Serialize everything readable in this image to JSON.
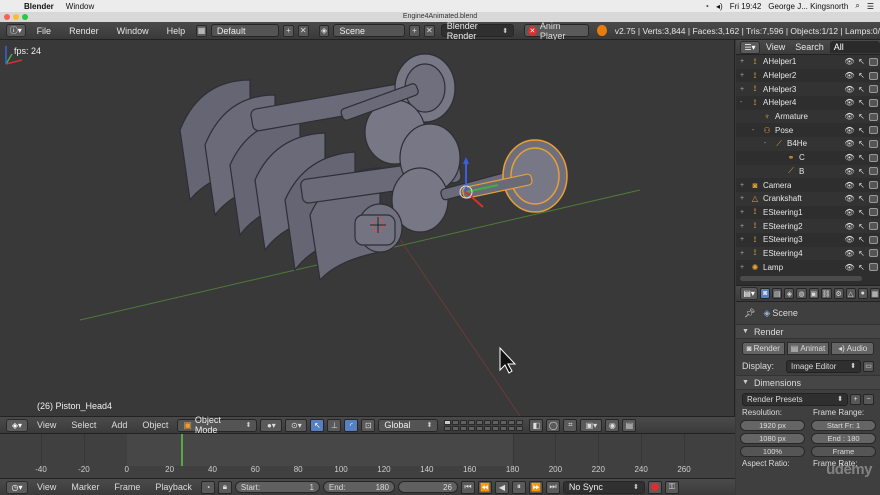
{
  "os_menu": {
    "apple": "",
    "app_name": "Blender",
    "items": [
      "Window"
    ],
    "clock": "Fri 19:42",
    "user": "George J... Kingsnorth"
  },
  "window": {
    "title": "Engine4Animated.blend"
  },
  "info_header": {
    "menus": [
      "File",
      "Render",
      "Window",
      "Help"
    ],
    "layout": "Default",
    "scene": "Scene",
    "render_engine": "Blender Render",
    "anim_player": "Anim Player",
    "stats": "v2.75 | Verts:3,844 | Faces:3,162 | Tris:7,596 | Objects:1/12 | Lamps:0/"
  },
  "viewport": {
    "fps": "fps: 24",
    "active_object": "(26) Piston_Head4"
  },
  "viewport_header": {
    "menus": [
      "View",
      "Select",
      "Add",
      "Object"
    ],
    "mode": "Object Mode",
    "orientation": "Global"
  },
  "timeline": {
    "ticks": [
      "-40",
      "-20",
      "0",
      "20",
      "40",
      "60",
      "80",
      "100",
      "120",
      "140",
      "160",
      "180",
      "200",
      "220",
      "240",
      "260"
    ],
    "range_start": 0,
    "range_end": 180,
    "current_frame": 26,
    "tick_min": -40,
    "tick_max": 260
  },
  "timeline_header": {
    "menus": [
      "View",
      "Marker",
      "Frame",
      "Playback"
    ],
    "start_label": "Start:",
    "start_value": "1",
    "end_label": "End:",
    "end_value": "180",
    "current": "26",
    "sync": "No Sync"
  },
  "outliner": {
    "tabs": [
      "View",
      "Search",
      "All Scenes"
    ],
    "rows": [
      {
        "name": "AHelper1",
        "icon": "empty-icon",
        "indent": 0,
        "expand": "+"
      },
      {
        "name": "AHelper2",
        "icon": "empty-icon",
        "indent": 0,
        "expand": "+"
      },
      {
        "name": "AHelper3",
        "icon": "empty-icon",
        "indent": 0,
        "expand": "+"
      },
      {
        "name": "AHelper4",
        "icon": "empty-icon",
        "indent": 0,
        "expand": "-"
      },
      {
        "name": "Armature",
        "icon": "armature-icon",
        "indent": 1,
        "expand": ""
      },
      {
        "name": "Pose",
        "icon": "pose-icon",
        "indent": 1,
        "expand": "-"
      },
      {
        "name": "B4He",
        "icon": "bone-icon",
        "indent": 2,
        "expand": "-"
      },
      {
        "name": "C",
        "icon": "constraint-icon",
        "indent": 3,
        "expand": ""
      },
      {
        "name": "B",
        "icon": "bone-icon",
        "indent": 3,
        "expand": ""
      },
      {
        "name": "Camera",
        "icon": "camera-icon",
        "indent": 0,
        "expand": "+"
      },
      {
        "name": "Crankshaft",
        "icon": "mesh-icon",
        "indent": 0,
        "expand": "+"
      },
      {
        "name": "ESteering1",
        "icon": "empty-icon",
        "indent": 0,
        "expand": "+"
      },
      {
        "name": "ESteering2",
        "icon": "empty-icon",
        "indent": 0,
        "expand": "+"
      },
      {
        "name": "ESteering3",
        "icon": "empty-icon",
        "indent": 0,
        "expand": "+"
      },
      {
        "name": "ESteering4",
        "icon": "empty-icon",
        "indent": 0,
        "expand": "+"
      },
      {
        "name": "Lamp",
        "icon": "lamp-icon",
        "indent": 0,
        "expand": "+"
      }
    ]
  },
  "properties": {
    "crumb": "Scene",
    "render_panel": "Render",
    "render_buttons": [
      "Render",
      "Animat",
      "Audio"
    ],
    "display_label": "Display:",
    "display_value": "Image Editor",
    "dimensions_panel": "Dimensions",
    "presets": "Render Presets",
    "resolution_label": "Resolution:",
    "res_x": "1920 px",
    "res_y": "1080 px",
    "res_pct": "100%",
    "frame_range_label": "Frame Range:",
    "start_frame": "Start Fr: 1",
    "end_frame": "End : 180",
    "frame_step": "Frame",
    "aspect_label": "Aspect Ratio:",
    "frame_rate_label": "Frame Rate:"
  },
  "watermark": "udemy",
  "colors": {
    "accent": "#5680c2",
    "selection": "#e8a035",
    "timeline_cursor": "#5aa845",
    "brand_orange": "#e87d0d"
  }
}
